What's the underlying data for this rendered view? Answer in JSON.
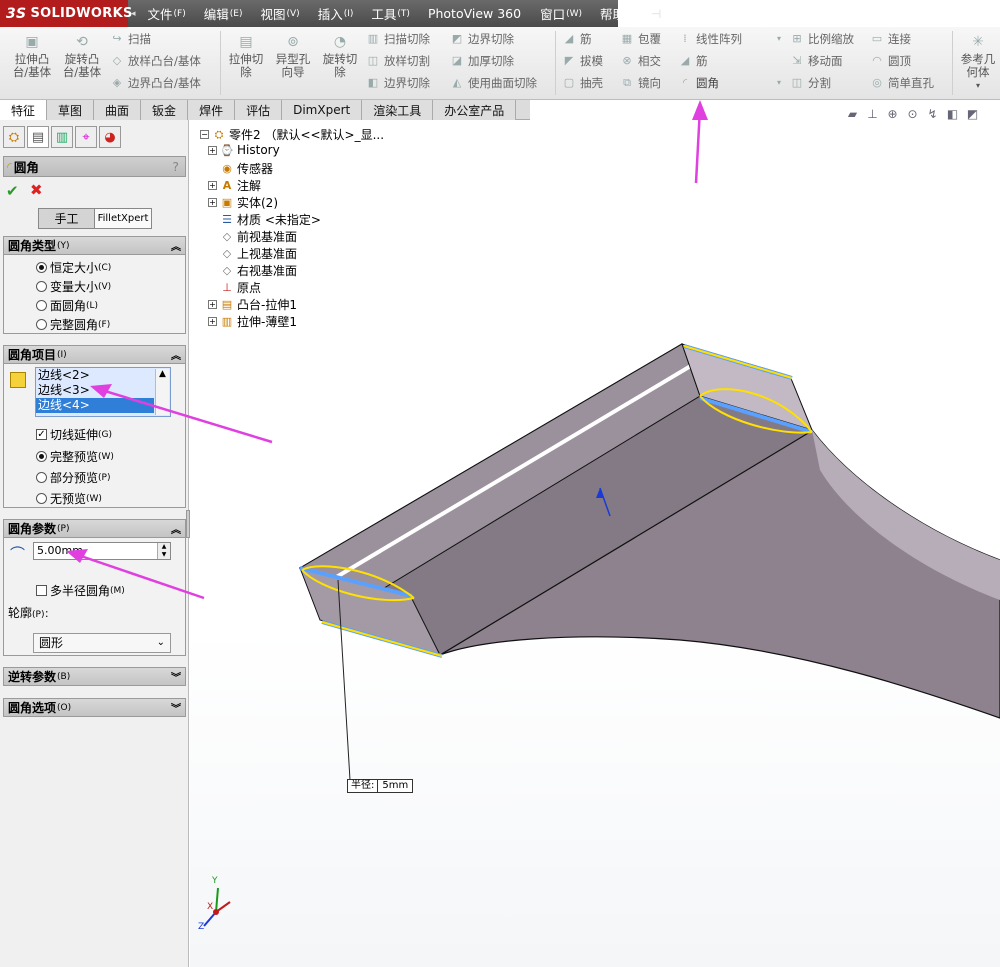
{
  "app": {
    "logo": "SOLIDWORKS",
    "logo_mark": "3S"
  },
  "menubar": [
    {
      "label": "文件",
      "key": "(F)"
    },
    {
      "label": "编辑",
      "key": "(E)"
    },
    {
      "label": "视图",
      "key": "(V)"
    },
    {
      "label": "插入",
      "key": "(I)"
    },
    {
      "label": "工具",
      "key": "(T)"
    },
    {
      "label": "PhotoView 360",
      "key": ""
    },
    {
      "label": "窗口",
      "key": "(W)"
    },
    {
      "label": "帮助",
      "key": "(H)"
    }
  ],
  "ribbon": {
    "extrude_boss": "拉伸凸\n台/基体",
    "revolve_boss": "旋转凸\n台/基体",
    "sweep": "扫描",
    "loft_boss": "放样凸台/基体",
    "boundary_boss": "边界凸台/基体",
    "extrude_cut": "拉伸切\n除",
    "hole_wizard": "异型孔\n向导",
    "revolve_cut": "旋转切\n除",
    "sweep_cut": "扫描切除",
    "loft_cut": "放样切割",
    "boundary_cut": "边界切除",
    "boundary_cut2": "边界切除",
    "thicken_cut": "加厚切除",
    "surface_cut": "使用曲面切除",
    "rib": "筋",
    "draft": "拔模",
    "shell": "抽壳",
    "wrap": "包覆",
    "intersect": "相交",
    "mirror": "镜向",
    "linear_pattern": "线性阵列",
    "rib2": "筋",
    "fillet": "圆角",
    "scale": "比例缩放",
    "move_face": "移动面",
    "split": "分割",
    "connect": "连接",
    "dome": "圆顶",
    "simple_hole": "简单直孔",
    "ref_geometry": "参考几\n何体"
  },
  "tabs": [
    "特征",
    "草图",
    "曲面",
    "钣金",
    "焊件",
    "评估",
    "DimXpert",
    "渲染工具",
    "办公室产品"
  ],
  "property_manager": {
    "title": "圆角",
    "help": "?",
    "mode_manual": "手工",
    "mode_xpert": "FilletXpert",
    "fillet_type": {
      "header": "圆角类型",
      "key": "(Y)",
      "options": [
        {
          "label": "恒定大小",
          "key": "(C)"
        },
        {
          "label": "变量大小",
          "key": "(V)"
        },
        {
          "label": "面圆角",
          "key": "(L)"
        },
        {
          "label": "完整圆角",
          "key": "(F)"
        }
      ]
    },
    "fillet_items": {
      "header": "圆角项目",
      "key": "(I)",
      "edges": [
        "边线<2>",
        "边线<3>",
        "边线<4>"
      ],
      "tangent_propagation": {
        "label": "切线延伸",
        "key": "(G)"
      },
      "previews": [
        {
          "label": "完整预览",
          "key": "(W)"
        },
        {
          "label": "部分预览",
          "key": "(P)"
        },
        {
          "label": "无预览",
          "key": "(W)"
        }
      ]
    },
    "fillet_params": {
      "header": "圆角参数",
      "key": "(P)",
      "radius": "5.00mm",
      "multi_radius": {
        "label": "多半径圆角",
        "key": "(M)"
      },
      "profile_label": "轮廓",
      "profile_key": "(P)：",
      "profile_value": "圆形"
    },
    "setback": {
      "header": "逆转参数",
      "key": "(B)"
    },
    "options": {
      "header": "圆角选项",
      "key": "(O)"
    }
  },
  "tree": {
    "root": "零件2 （默认<<默认>_显...",
    "items": [
      "History",
      "传感器",
      "注解",
      "实体(2)",
      "材质 <未指定>",
      "前视基准面",
      "上视基准面",
      "右视基准面",
      "原点",
      "凸台-拉伸1",
      "拉伸-薄壁1"
    ]
  },
  "callout": {
    "label": "半径:",
    "value": "5mm"
  },
  "triad": {
    "x": "X",
    "y": "Y",
    "z": "Z"
  },
  "colors": {
    "accent": "#e040e0",
    "selection": "#ffe000",
    "edge_highlight": "#5aa0ff",
    "part": "#857a85"
  }
}
